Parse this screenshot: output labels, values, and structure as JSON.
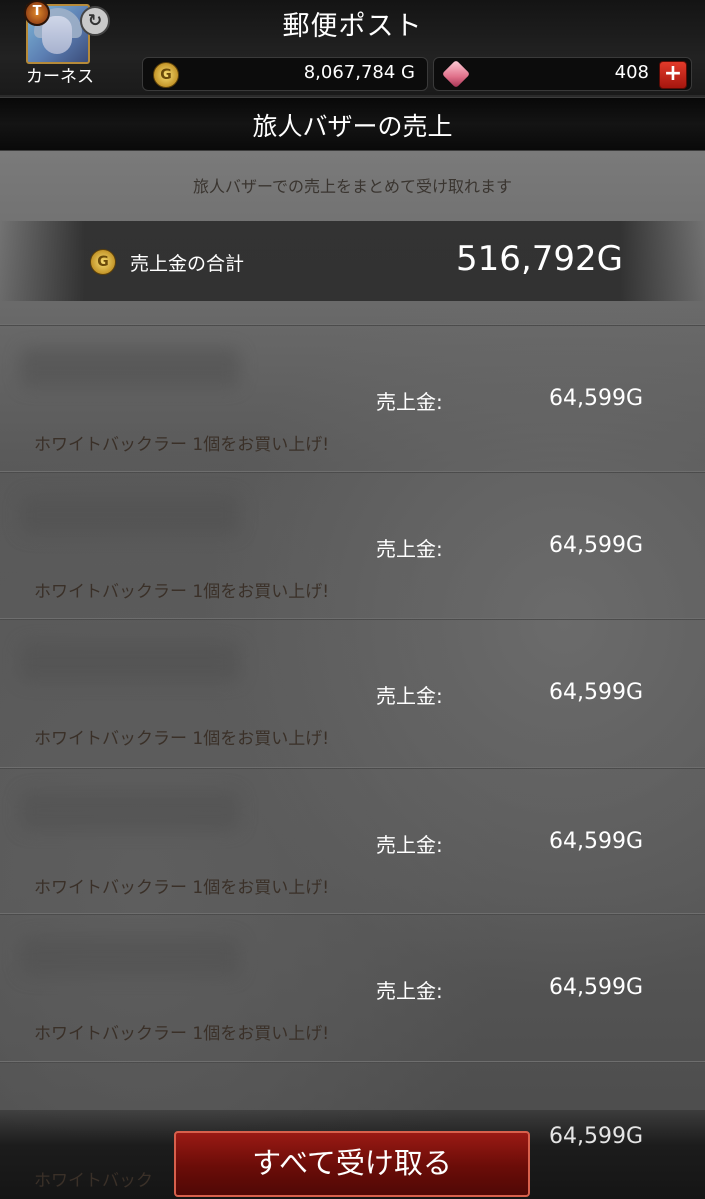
{
  "header": {
    "title": "郵便ポスト",
    "character_name": "カーネス",
    "gold": "8,067,784 G",
    "gems": "408",
    "gold_icon_glyph": "G",
    "crest_glyph": "T",
    "swap_glyph": "↻",
    "plus_glyph": "+"
  },
  "section": {
    "title": "旅人バザーの売上",
    "description": "旅人バザーでの売上をまとめて受け取れます"
  },
  "total": {
    "label": "売上金の合計",
    "value": "516,792G"
  },
  "sales": [
    {
      "label": "売上金:",
      "value": "64,599G",
      "item": "ホワイトバックラー 1個をお買い上げ!"
    },
    {
      "label": "売上金:",
      "value": "64,599G",
      "item": "ホワイトバックラー 1個をお買い上げ!"
    },
    {
      "label": "売上金:",
      "value": "64,599G",
      "item": "ホワイトバックラー 1個をお買い上げ!"
    },
    {
      "label": "売上金:",
      "value": "64,599G",
      "item": "ホワイトバックラー 1個をお買い上げ!"
    },
    {
      "label": "売上金:",
      "value": "64,599G",
      "item": "ホワイトバックラー 1個をお買い上げ!"
    }
  ],
  "partial_sale": {
    "value": "64,599G",
    "item": "ホワイトバック"
  },
  "footer": {
    "receive_all_label": "すべて受け取る"
  },
  "icons": {
    "avatar": "character-portrait",
    "crest": "crest-icon",
    "swap": "swap-character-icon",
    "gold": "gold-coin-icon",
    "gem": "gem-icon",
    "plus": "plus-icon"
  },
  "colors": {
    "accent_red": "#9a1a14",
    "coin_gold": "#c4962a",
    "gem_pink": "#e0708a"
  }
}
